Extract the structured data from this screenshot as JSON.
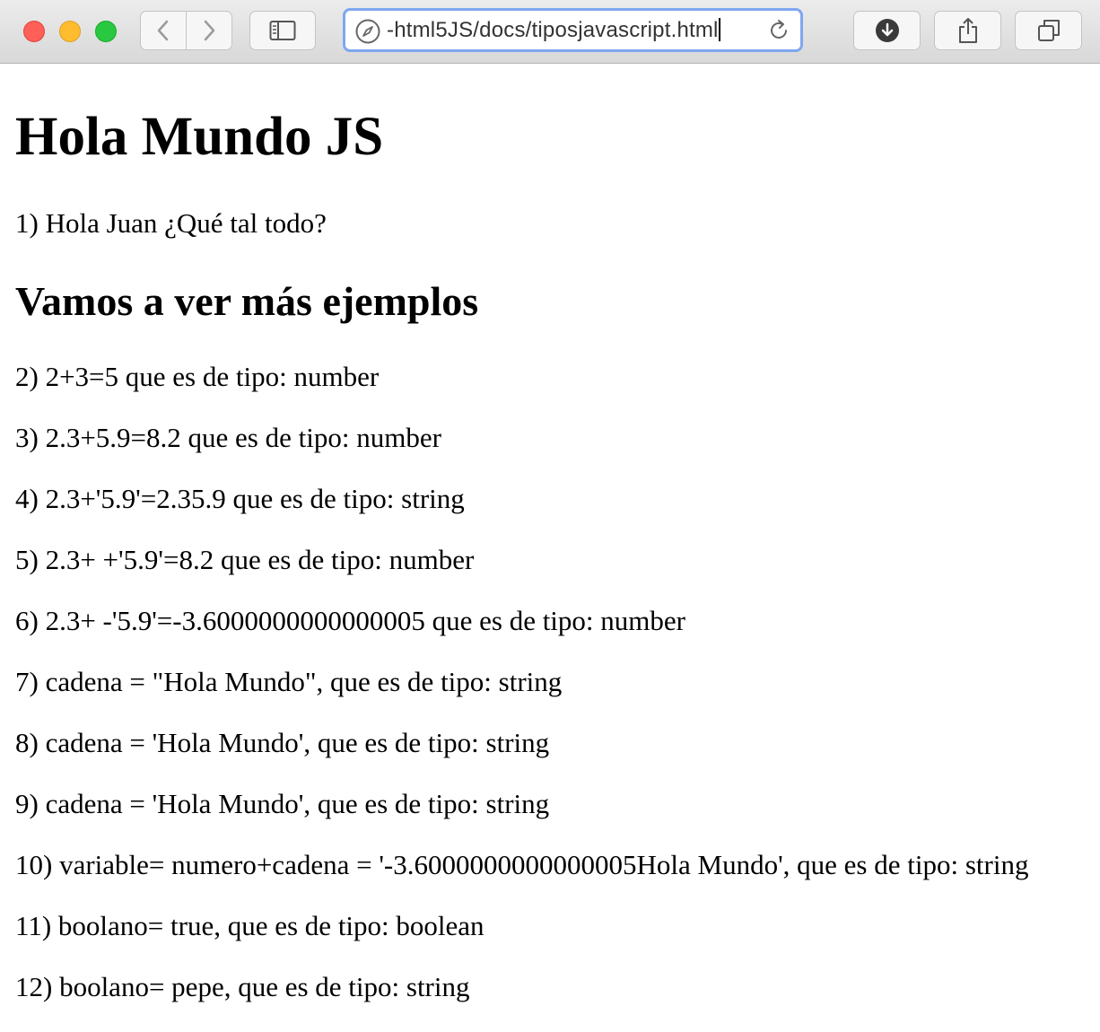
{
  "browser": {
    "url": "-html5JS/docs/tiposjavascript.html",
    "icons": {
      "back": "chevron-left-icon",
      "forward": "chevron-right-icon",
      "sidebar": "sidebar-icon",
      "compass": "compass-icon",
      "reload": "reload-icon",
      "download": "download-icon",
      "share": "share-icon",
      "tabs": "tabs-icon"
    },
    "traffic_colors": {
      "close": "#fe5f57",
      "minimize": "#febc2e",
      "maximize": "#28c840"
    }
  },
  "page": {
    "heading": "Hola Mundo JS",
    "intro": "1) Hola Juan ¿Qué tal todo?",
    "subheading": "Vamos a ver más ejemplos",
    "results": [
      "2) 2+3=5 que es de tipo: number",
      "3) 2.3+5.9=8.2 que es de tipo: number",
      "4) 2.3+'5.9'=2.35.9 que es de tipo: string",
      "5) 2.3+ +'5.9'=8.2 que es de tipo: number",
      "6) 2.3+ -'5.9'=-3.6000000000000005 que es de tipo: number",
      "7) cadena = \"Hola Mundo\", que es de tipo: string",
      "8) cadena = 'Hola Mundo', que es de tipo: string",
      "9) cadena = 'Hola Mundo', que es de tipo: string",
      "10) variable= numero+cadena = '-3.6000000000000005Hola Mundo', que es de tipo: string",
      "11) boolano= true, que es de tipo: boolean",
      "12) boolano= pepe, que es de tipo: string"
    ]
  }
}
